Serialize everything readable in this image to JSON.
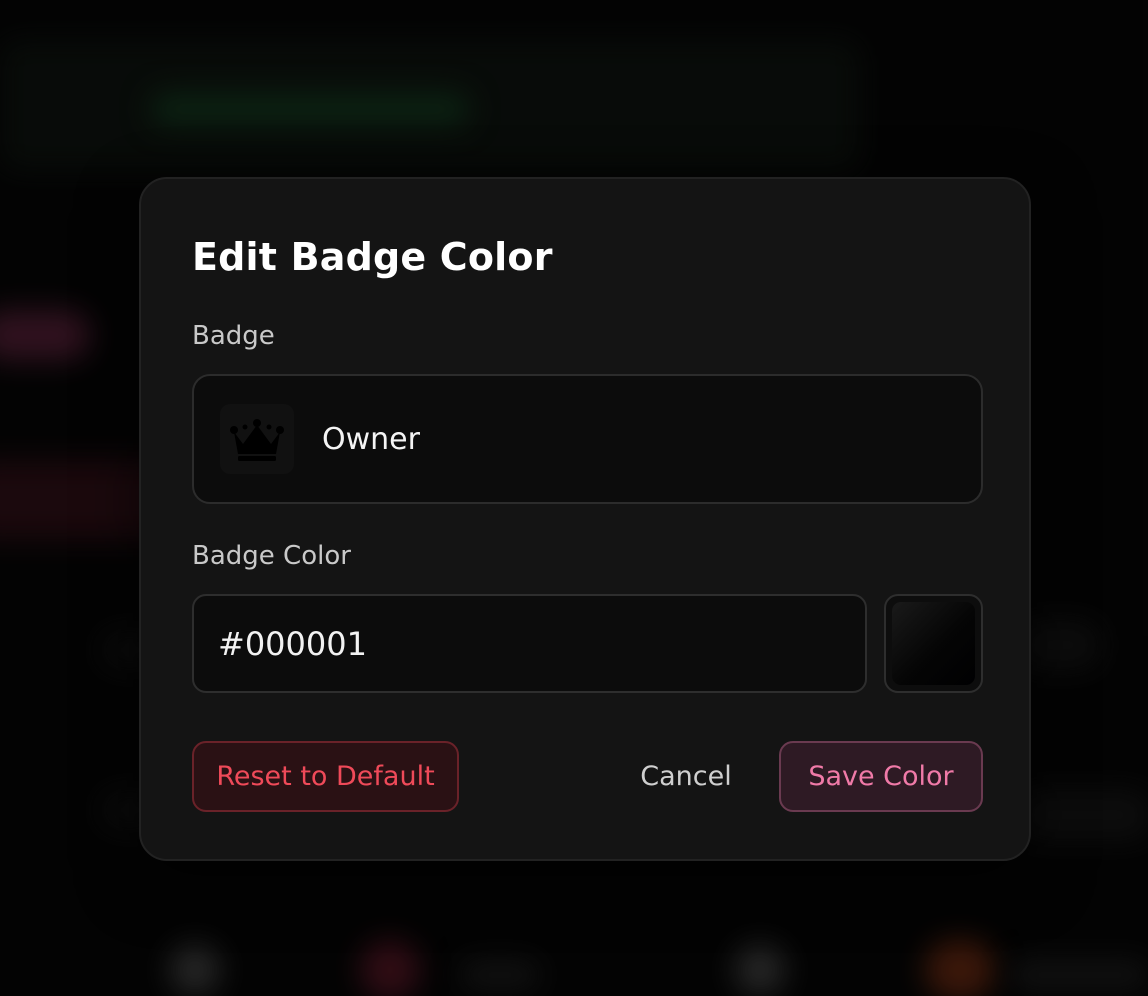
{
  "dialog": {
    "title": "Edit Badge Color",
    "badge_label": "Badge",
    "badge": {
      "icon": "crown-icon",
      "name": "Owner"
    },
    "color_label": "Badge Color",
    "color_value": "#000001",
    "swatch_color": "#000001",
    "buttons": {
      "reset": "Reset to Default",
      "cancel": "Cancel",
      "save": "Save Color"
    }
  },
  "colors": {
    "modal_bg": "#141414",
    "reset_text": "#ef4a59",
    "save_text": "#f07aa8"
  }
}
